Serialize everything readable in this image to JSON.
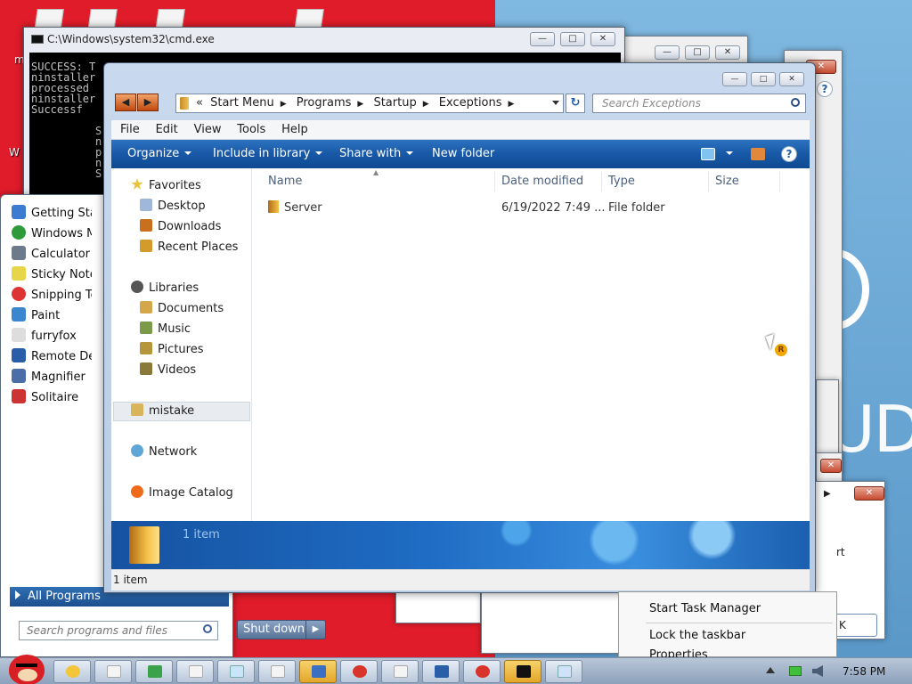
{
  "desktop": {
    "label_fragments": [
      "m",
      "W"
    ],
    "cloud_text": "UD"
  },
  "cmd_window": {
    "title": "C:\\Windows\\system32\\cmd.exe",
    "lines": [
      "SUCCESS: T",
      "ninstaller",
      "processed",
      "ninstaller",
      "Successf"
    ],
    "inner_lines": [
      "S",
      "n",
      "p",
      "n",
      "S"
    ]
  },
  "start_menu": {
    "items": [
      {
        "label": "Getting Started",
        "icon": "getting-started-icon",
        "color": "#3b7cd1"
      },
      {
        "label": "Windows Media Center",
        "icon": "windows-media-icon",
        "color": "#2f9a3a"
      },
      {
        "label": "Calculator",
        "icon": "calculator-icon",
        "color": "#6c7a8c"
      },
      {
        "label": "Sticky Notes",
        "icon": "sticky-notes-icon",
        "color": "#e8d64a"
      },
      {
        "label": "Snipping Tool",
        "icon": "snipping-tool-icon",
        "color": "#d33"
      },
      {
        "label": "Paint",
        "icon": "paint-icon",
        "color": "#3a87d0"
      },
      {
        "label": "furryfox",
        "icon": "furryfox-icon",
        "color": "#ddd"
      },
      {
        "label": "Remote Desktop Connection",
        "icon": "remote-desktop-icon",
        "color": "#2a5ea8"
      },
      {
        "label": "Magnifier",
        "icon": "magnifier-icon",
        "color": "#4b6ea8"
      },
      {
        "label": "Solitaire",
        "icon": "solitaire-icon",
        "color": "#c33"
      }
    ],
    "all_programs": "All Programs",
    "search_placeholder": "Search programs and files",
    "shutdown": "Shut down"
  },
  "explorer": {
    "address": {
      "crumbs": [
        "Start Menu",
        "Programs",
        "Startup",
        "Exceptions"
      ],
      "lead": "«"
    },
    "search_placeholder": "Search Exceptions",
    "menu": [
      "File",
      "Edit",
      "View",
      "Tools",
      "Help"
    ],
    "toolbar": {
      "organize": "Organize",
      "include": "Include in library",
      "share": "Share with",
      "new_folder": "New folder",
      "help": "?"
    },
    "nav": {
      "favorites": "Favorites",
      "desktop": "Desktop",
      "downloads": "Downloads",
      "recent": "Recent Places",
      "libraries": "Libraries",
      "documents": "Documents",
      "music": "Music",
      "pictures": "Pictures",
      "videos": "Videos",
      "mistake": "mistake",
      "network": "Network",
      "image_catalog": "Image Catalog"
    },
    "columns": {
      "name": "Name",
      "date": "Date modified",
      "type": "Type",
      "size": "Size"
    },
    "files": [
      {
        "name": "Server",
        "date": "6/19/2022 7:49 ...",
        "type": "File folder",
        "size": ""
      }
    ],
    "details_count": "1 item",
    "status": "1 item"
  },
  "context_menu": {
    "items": [
      "Start Task Manager",
      "Lock the taskbar",
      "Properties"
    ],
    "fragments": [
      "rt",
      "K"
    ]
  },
  "taskbar": {
    "time": "7:58 PM",
    "buttons": [
      {
        "icon": "folder-star-icon",
        "color": "#f2c53b",
        "active": false
      },
      {
        "icon": "window-icon",
        "color": "#f4f4f4",
        "active": false
      },
      {
        "icon": "explorer-icon",
        "color": "#3aa24a",
        "active": false
      },
      {
        "icon": "window-icon",
        "color": "#f4f4f4",
        "active": false
      },
      {
        "icon": "notepad-icon",
        "color": "#c8e6f8",
        "active": false
      },
      {
        "icon": "window-icon",
        "color": "#f4f4f4",
        "active": false
      },
      {
        "icon": "installer-icon",
        "color": "#3a6fc4",
        "active": true
      },
      {
        "icon": "error-icon",
        "color": "#d9342b",
        "active": false
      },
      {
        "icon": "window-icon",
        "color": "#f4f4f4",
        "active": false
      },
      {
        "icon": "network-icon",
        "color": "#2a5ea8",
        "active": false
      },
      {
        "icon": "stop-icon",
        "color": "#d9342b",
        "active": false
      },
      {
        "icon": "cmd-icon",
        "color": "#111111",
        "active": true
      },
      {
        "icon": "document-icon",
        "color": "#cfe2f7",
        "active": false
      }
    ]
  }
}
